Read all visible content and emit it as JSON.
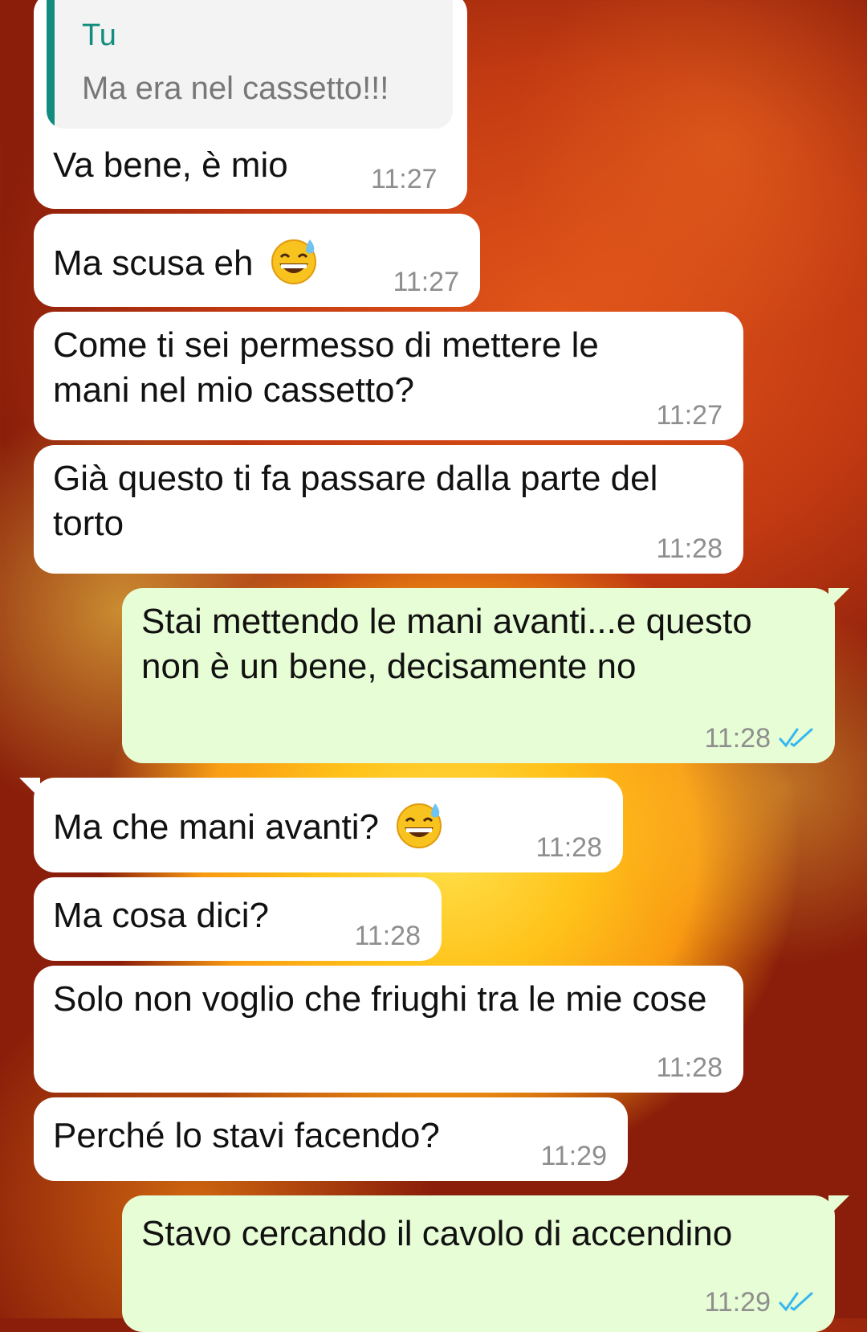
{
  "reply_quote": {
    "author": "Tu",
    "text": "Ma era nel cassetto!!!"
  },
  "messages": [
    {
      "text": "Va bene, è mio",
      "time": "11:27",
      "direction": "incoming"
    },
    {
      "text": "Ma scusa eh",
      "emoji": "grinning-sweat",
      "time": "11:27",
      "direction": "incoming"
    },
    {
      "text": "Come ti sei permesso di mettere le mani nel mio cassetto?",
      "time": "11:27",
      "direction": "incoming"
    },
    {
      "text": "Già questo ti fa passare dalla parte del torto",
      "time": "11:28",
      "direction": "incoming"
    },
    {
      "text": "Stai mettendo le mani avanti...e questo non è un bene, decisamente no",
      "time": "11:28",
      "direction": "outgoing",
      "status": "read"
    },
    {
      "text": "Ma che mani avanti?",
      "emoji": "grinning-sweat",
      "time": "11:28",
      "direction": "incoming"
    },
    {
      "text": "Ma cosa dici?",
      "time": "11:28",
      "direction": "incoming"
    },
    {
      "text": "Solo non voglio che friughi tra le mie cose",
      "time": "11:28",
      "direction": "incoming"
    },
    {
      "text": "Perché lo stavi facendo?",
      "time": "11:29",
      "direction": "incoming"
    },
    {
      "text": "Stavo cercando il cavolo di accendino",
      "time": "11:29",
      "direction": "outgoing",
      "status": "read"
    }
  ],
  "colors": {
    "incoming_bubble": "#ffffff",
    "outgoing_bubble": "#e7fdd5",
    "quote_accent": "#128c7e",
    "read_ticks": "#34b7f1",
    "timestamp": "#8e8e8e"
  },
  "icons": {
    "read_status": "double-check-icon",
    "emoji": "grinning-face-with-sweat-emoji"
  }
}
